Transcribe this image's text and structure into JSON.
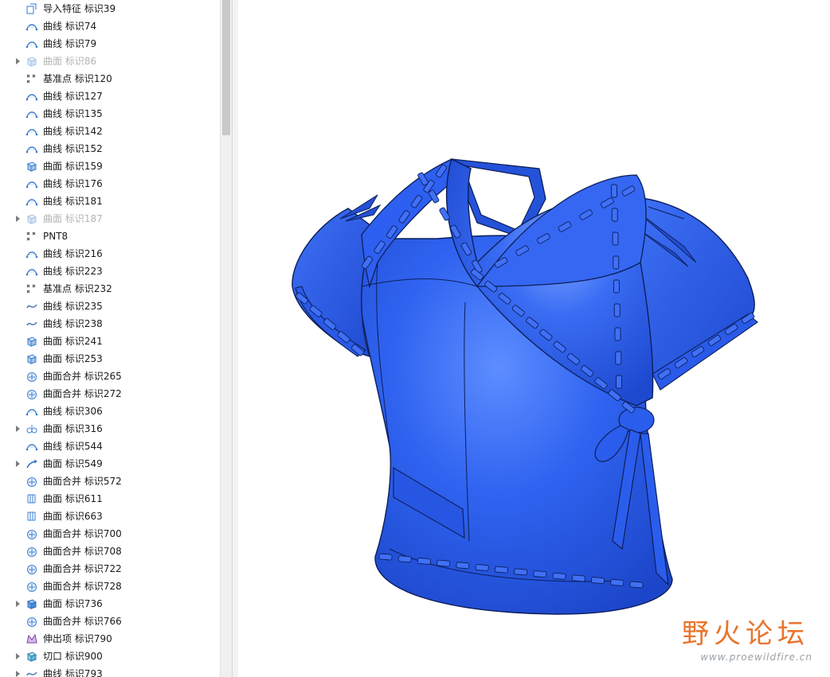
{
  "tree": {
    "items": [
      {
        "label": "导入特征 标识39",
        "icon": "import-feature-icon",
        "expandable": false,
        "dimmed": false
      },
      {
        "label": "曲线 标识74",
        "icon": "curve-icon",
        "expandable": false,
        "dimmed": false
      },
      {
        "label": "曲线 标识79",
        "icon": "curve-icon",
        "expandable": false,
        "dimmed": false
      },
      {
        "label": "曲面 标识86",
        "icon": "surface-icon",
        "expandable": true,
        "dimmed": true
      },
      {
        "label": "基准点 标识120",
        "icon": "datum-point-icon",
        "expandable": false,
        "dimmed": false
      },
      {
        "label": "曲线 标识127",
        "icon": "curve-icon",
        "expandable": false,
        "dimmed": false
      },
      {
        "label": "曲线 标识135",
        "icon": "curve-icon",
        "expandable": false,
        "dimmed": false
      },
      {
        "label": "曲线 标识142",
        "icon": "curve-icon",
        "expandable": false,
        "dimmed": false
      },
      {
        "label": "曲线 标识152",
        "icon": "curve-icon",
        "expandable": false,
        "dimmed": false
      },
      {
        "label": "曲面 标识159",
        "icon": "surface-icon",
        "expandable": false,
        "dimmed": false
      },
      {
        "label": "曲线 标识176",
        "icon": "curve-icon",
        "expandable": false,
        "dimmed": false
      },
      {
        "label": "曲线 标识181",
        "icon": "curve-icon",
        "expandable": false,
        "dimmed": false
      },
      {
        "label": "曲面 标识187",
        "icon": "surface-icon",
        "expandable": true,
        "dimmed": true
      },
      {
        "label": "PNT8",
        "icon": "datum-point-icon",
        "expandable": false,
        "dimmed": false
      },
      {
        "label": "曲线 标识216",
        "icon": "curve-icon",
        "expandable": false,
        "dimmed": false
      },
      {
        "label": "曲线 标识223",
        "icon": "curve-icon",
        "expandable": false,
        "dimmed": false
      },
      {
        "label": "基准点 标识232",
        "icon": "datum-point-icon",
        "expandable": false,
        "dimmed": false
      },
      {
        "label": "曲线 标识235",
        "icon": "sketch-curve-icon",
        "expandable": false,
        "dimmed": false
      },
      {
        "label": "曲线 标识238",
        "icon": "sketch-curve-icon",
        "expandable": false,
        "dimmed": false
      },
      {
        "label": "曲面 标识241",
        "icon": "surface-icon",
        "expandable": false,
        "dimmed": false
      },
      {
        "label": "曲面 标识253",
        "icon": "surface-icon",
        "expandable": false,
        "dimmed": false
      },
      {
        "label": "曲面合并 标识265",
        "icon": "merge-icon",
        "expandable": false,
        "dimmed": false
      },
      {
        "label": "曲面合并 标识272",
        "icon": "merge-icon",
        "expandable": false,
        "dimmed": false
      },
      {
        "label": "曲线 标识306",
        "icon": "curve-icon",
        "expandable": false,
        "dimmed": false
      },
      {
        "label": "曲面 标识316",
        "icon": "copy-surface-icon",
        "expandable": true,
        "dimmed": false
      },
      {
        "label": "曲线 标识544",
        "icon": "curve-icon",
        "expandable": false,
        "dimmed": false
      },
      {
        "label": "曲面 标识549",
        "icon": "sweep-surface-icon",
        "expandable": true,
        "dimmed": false
      },
      {
        "label": "曲面合并 标识572",
        "icon": "merge-icon",
        "expandable": false,
        "dimmed": false
      },
      {
        "label": "曲面 标识611",
        "icon": "boundary-surface-icon",
        "expandable": false,
        "dimmed": false
      },
      {
        "label": "曲面 标识663",
        "icon": "boundary-surface-icon",
        "expandable": false,
        "dimmed": false
      },
      {
        "label": "曲面合并 标识700",
        "icon": "merge-icon",
        "expandable": false,
        "dimmed": false
      },
      {
        "label": "曲面合并 标识708",
        "icon": "merge-icon",
        "expandable": false,
        "dimmed": false
      },
      {
        "label": "曲面合并 标识722",
        "icon": "merge-icon",
        "expandable": false,
        "dimmed": false
      },
      {
        "label": "曲面合并 标识728",
        "icon": "merge-icon",
        "expandable": false,
        "dimmed": false
      },
      {
        "label": "曲面 标识736",
        "icon": "solid-surface-icon",
        "expandable": true,
        "dimmed": false
      },
      {
        "label": "曲面合并 标识766",
        "icon": "merge-icon",
        "expandable": false,
        "dimmed": false
      },
      {
        "label": "伸出项 标识790",
        "icon": "protrusion-icon",
        "expandable": false,
        "dimmed": false
      },
      {
        "label": "切口 标识900",
        "icon": "cut-icon",
        "expandable": true,
        "dimmed": false
      },
      {
        "label": "曲线 标识793",
        "icon": "sketch-curve-icon",
        "expandable": true,
        "dimmed": false
      }
    ]
  },
  "viewport": {
    "model_color": "#2f63f0",
    "model_dark": "#1c46c9",
    "model_light": "#6f9cff",
    "edge_color": "#0d1f5a"
  },
  "watermark": {
    "title": "野火论坛",
    "url": "www.proewildfire.cn",
    "color": "#e8742c"
  }
}
